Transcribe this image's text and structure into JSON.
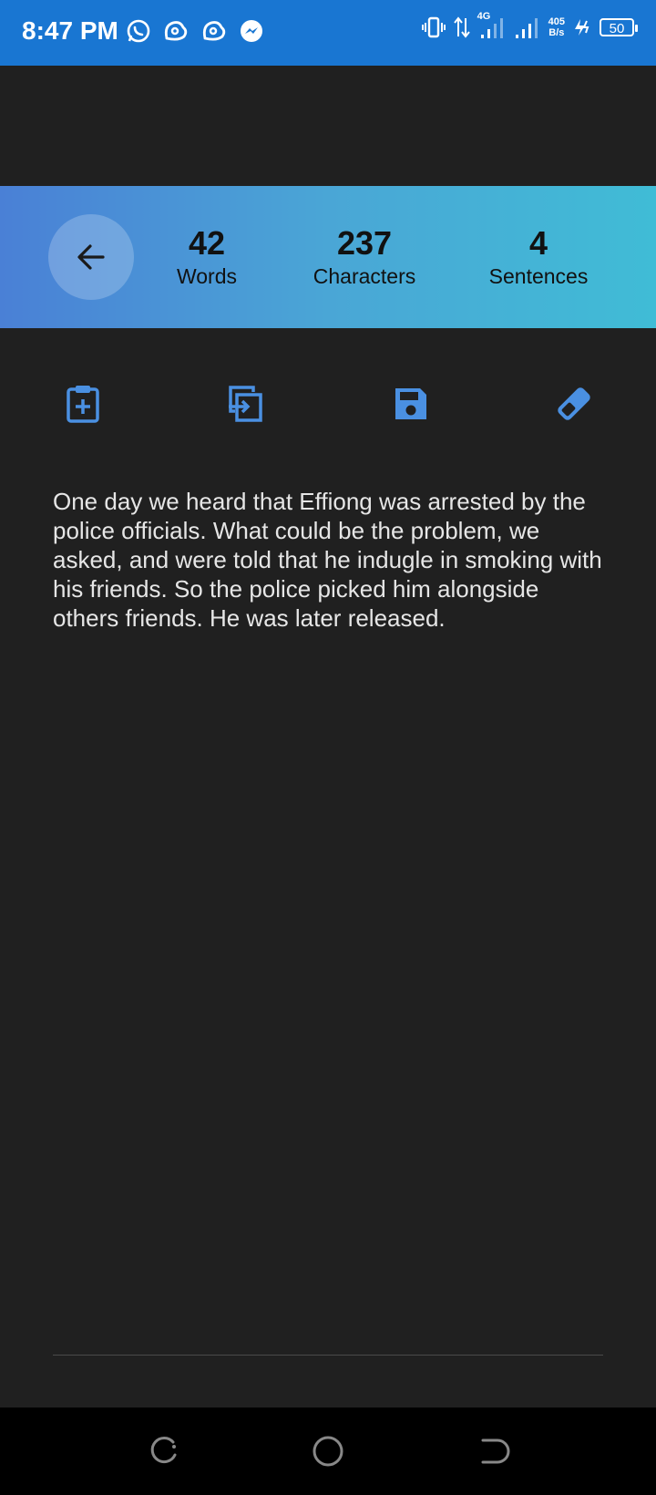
{
  "status_bar": {
    "time": "8:47 PM",
    "network_type": "4G",
    "net_speed_value": "405",
    "net_speed_unit": "B/s",
    "battery": "50"
  },
  "stats": {
    "words_count": "42",
    "words_label": "Words",
    "characters_count": "237",
    "characters_label": "Characters",
    "sentences_count": "4",
    "sentences_label": "Sentences"
  },
  "toolbar": {
    "icons": [
      "paste-icon",
      "copy-icon",
      "save-icon",
      "eraser-icon"
    ]
  },
  "content": {
    "text": "One day we heard that Effiong was arrested by the police officials. What could be the problem, we asked, and were told that he indugle in smoking with his friends. So the police picked him alongside others friends. He was later released."
  },
  "colors": {
    "status_bar": "#1976d2",
    "background": "#202020",
    "accent": "#4a90e2",
    "gradient_start": "#4a80d6",
    "gradient_end": "#40bcd6"
  }
}
